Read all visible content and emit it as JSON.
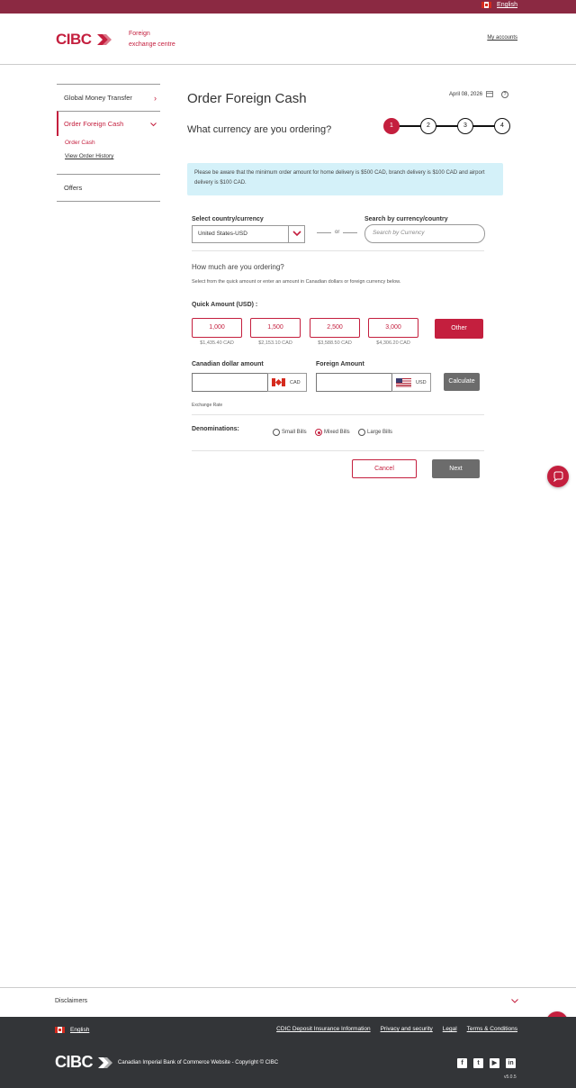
{
  "top_bar": {
    "language": "English"
  },
  "header": {
    "logo": "CIBC",
    "site_name_line1": "Foreign",
    "site_name_line2": "exchange centre",
    "my_accounts": "My accounts"
  },
  "sidebar": {
    "global_money_transfer": "Global Money Transfer",
    "order_foreign_cash": "Order Foreign Cash",
    "order_cash": "Order Cash",
    "view_order_history": "View Order History",
    "offers": "Offers"
  },
  "main": {
    "title": "Order Foreign Cash",
    "date": "April 08, 2026",
    "subtitle": "What currency are you ordering?",
    "steps": [
      "1",
      "2",
      "3",
      "4"
    ],
    "current_step": 1,
    "notice": "Please be aware that the minimum order amount for home delivery is $500 CAD, branch delivery is $100 CAD and airport delivery is $100 CAD.",
    "select_label": "Select country/currency",
    "select_value": "United States-USD",
    "or_text": "or",
    "search_label": "Search by currency/country",
    "search_placeholder": "Search by Currency",
    "how_much": "How much are you ordering?",
    "how_much_desc": "Select from the quick amount or enter an amount in Canadian dollars or foreign currency below.",
    "quick_amount_label": "Quick Amount (USD) :",
    "quick_amounts": [
      {
        "amount": "1,000",
        "cad": "$1,435.40 CAD"
      },
      {
        "amount": "1,500",
        "cad": "$2,153.10 CAD"
      },
      {
        "amount": "2,500",
        "cad": "$3,588.50 CAD"
      },
      {
        "amount": "3,000",
        "cad": "$4,306.20 CAD"
      }
    ],
    "other_label": "Other",
    "cad_amount_label": "Canadian dollar amount",
    "cad_code": "CAD",
    "foreign_amount_label": "Foreign Amount",
    "usd_code": "USD",
    "calculate": "Calculate",
    "exchange_rate": "Exchange Rate",
    "denominations_label": "Denominations:",
    "denominations": [
      "Small Bills",
      "Mixed Bills",
      "Large Bills"
    ],
    "selected_denomination": "Mixed Bills",
    "cancel": "Cancel",
    "next": "Next"
  },
  "footer": {
    "disclaimers": "Disclaimers",
    "language": "English",
    "links": [
      "CDIC Deposit Insurance Information",
      "Privacy and security",
      "Legal",
      "Terms & Conditions"
    ],
    "logo": "CIBC",
    "copyright": "Canadian Imperial Bank of Commerce Website - Copyright © CIBC",
    "social": [
      "facebook-icon",
      "twitter-icon",
      "youtube-icon",
      "linkedin-icon"
    ],
    "version": "v5.0.5"
  },
  "colors": {
    "brand": "#c41f3e",
    "topbar": "#8b2942",
    "footer_bg": "#333538",
    "notice_bg": "#d4f1f9"
  }
}
